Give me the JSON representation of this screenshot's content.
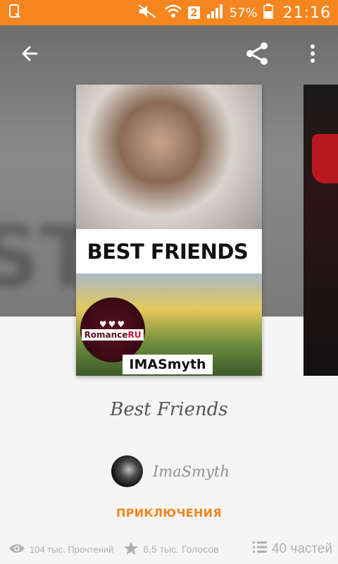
{
  "status_bar": {
    "sim_slot": "2",
    "battery": "57%",
    "time": "21:16"
  },
  "toolbar": {
    "back_icon": "arrow-left-icon",
    "share_icon": "share-icon",
    "more_icon": "more-vert-icon"
  },
  "cover": {
    "title_text": "BEST FRIENDS",
    "badge_hearts": "♥♥♥",
    "badge_text_main": "Romance",
    "badge_text_accent": "RU",
    "author_text": "IMASmyth"
  },
  "story": {
    "title": "Best Friends",
    "author": "ImaSmyth",
    "genre": "ПРИКЛЮЧЕНИЯ"
  },
  "stats": {
    "reads": "104 тыс. Прочтений",
    "votes": "6,5 тыс. Голосов",
    "parts": "40 частей"
  },
  "colors": {
    "accent": "#f5851f",
    "status_bar": "#f5851f",
    "muted_text": "#b0b0b0"
  }
}
